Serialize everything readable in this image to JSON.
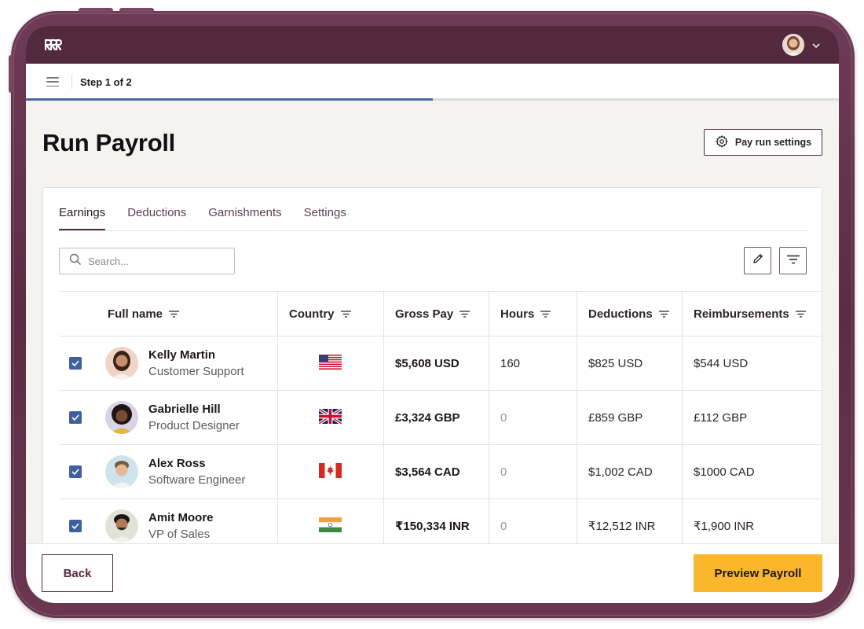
{
  "app": {
    "logo": "deel-logo-icon",
    "profile": {
      "avatar": "user-avatar",
      "menu_icon": "chevron-down-icon"
    }
  },
  "stepper": {
    "label": "Step 1 of 2",
    "progress": 0.5
  },
  "page": {
    "title": "Run Payroll",
    "settings_button": "Pay run settings"
  },
  "tabs": [
    {
      "label": "Earnings",
      "active": true
    },
    {
      "label": "Deductions",
      "active": false
    },
    {
      "label": "Garnishments",
      "active": false
    },
    {
      "label": "Settings",
      "active": false
    }
  ],
  "search": {
    "placeholder": "Search...",
    "value": ""
  },
  "table": {
    "columns": [
      "Full name",
      "Country",
      "Gross Pay",
      "Hours",
      "Deductions",
      "Reimbursements"
    ],
    "rows": [
      {
        "checked": true,
        "name": "Kelly Martin",
        "role": "Customer Support",
        "country": "US",
        "gross": "$5,608 USD",
        "hours": "160",
        "deductions": "$825 USD",
        "reimbursements": "$544 USD"
      },
      {
        "checked": true,
        "name": "Gabrielle Hill",
        "role": "Product Designer",
        "country": "GB",
        "gross": "£3,324 GBP",
        "hours": "0",
        "deductions": "£859 GBP",
        "reimbursements": "£112 GBP"
      },
      {
        "checked": true,
        "name": "Alex Ross",
        "role": "Software Engineer",
        "country": "CA",
        "gross": "$3,564 CAD",
        "hours": "0",
        "deductions": "$1,002 CAD",
        "reimbursements": "$1000 CAD"
      },
      {
        "checked": true,
        "name": "Amit Moore",
        "role": "VP of Sales",
        "country": "IN",
        "gross": "₹150,334 INR",
        "hours": "0",
        "deductions": "₹12,512 INR",
        "reimbursements": "₹1,900 INR"
      }
    ]
  },
  "footer": {
    "back_label": "Back",
    "preview_label": "Preview Payroll"
  },
  "colors": {
    "brand": "#53293e",
    "accent": "#fbb72c",
    "checkbox": "#3f5f9e",
    "progress": "#4a67a6"
  }
}
